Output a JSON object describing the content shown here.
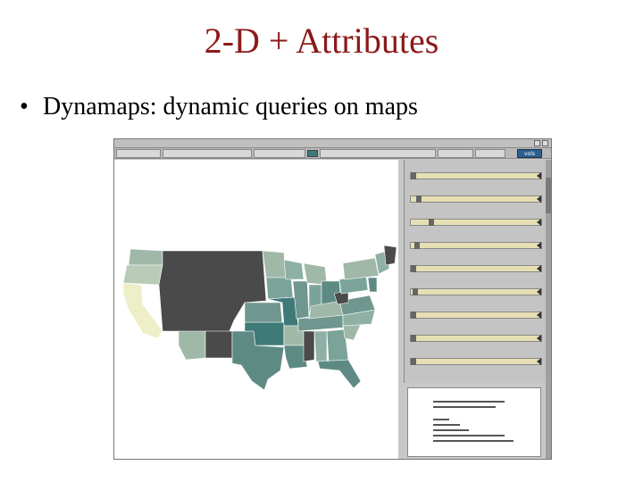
{
  "slide": {
    "title": "2-D + Attributes",
    "bullet": "•",
    "bullet_text": "Dynamaps:  dynamic queries on maps"
  },
  "app": {
    "logo_text": "vols",
    "colors": {
      "dark_state": "#4a4a4a",
      "teal": "#3e7a78",
      "sage": "#9fb8a8",
      "pale": "#eeeec8",
      "slider_track": "#e6dfb4"
    },
    "slider_count": 9
  }
}
